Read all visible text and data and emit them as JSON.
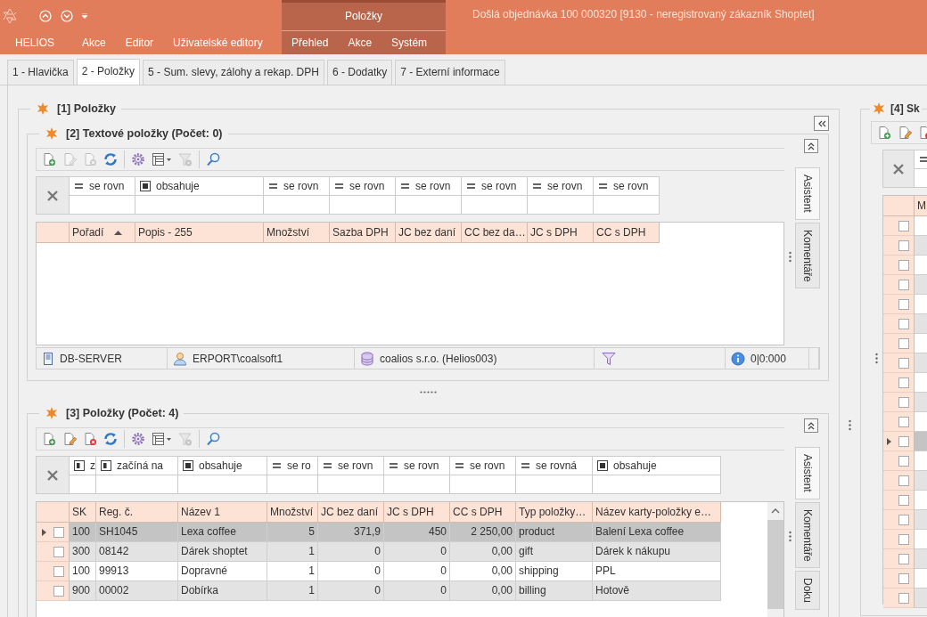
{
  "title_bar": {
    "title": "Došlá objednávka 100 000320 [9130 - neregistrovaný zákazník Shoptet]"
  },
  "ribbon": {
    "menu": [
      "HELIOS",
      "Akce",
      "Editor",
      "Uživatelské editory"
    ],
    "context_group": {
      "label": "Položky",
      "menu": [
        "Přehled",
        "Akce",
        "Systém"
      ]
    }
  },
  "tabs": [
    {
      "label": "1 - Hlavička",
      "selected": false
    },
    {
      "label": "2 - Položky",
      "selected": true
    },
    {
      "label": "5 - Sum. slevy, zálohy a rekap. DPH",
      "selected": false
    },
    {
      "label": "6 - Dodatky",
      "selected": false
    },
    {
      "label": "7 - Externí informace",
      "selected": false
    }
  ],
  "main_group": {
    "title": "[1] Položky"
  },
  "text_items": {
    "title": "[2] Textové položky (Počet: 0)",
    "toolbar": [
      {
        "kind": "add",
        "disabled": false
      },
      {
        "kind": "edit",
        "disabled": true
      },
      {
        "kind": "delete",
        "disabled": true
      },
      {
        "kind": "refresh",
        "disabled": false
      },
      {
        "kind": "separator"
      },
      {
        "kind": "settings",
        "disabled": false
      },
      {
        "kind": "columns",
        "disabled": false
      },
      {
        "kind": "filter_clear",
        "disabled": true
      },
      {
        "kind": "separator"
      },
      {
        "kind": "search",
        "disabled": false
      }
    ],
    "filters": [
      {
        "kind": "equals",
        "text": "se rovn"
      },
      {
        "kind": "contains",
        "text": "obsahuje"
      },
      {
        "kind": "equals",
        "text": "se rovn"
      },
      {
        "kind": "equals",
        "text": "se rovn"
      },
      {
        "kind": "equals",
        "text": "se rovn"
      },
      {
        "kind": "equals",
        "text": "se rovn"
      },
      {
        "kind": "equals",
        "text": "se rovn"
      },
      {
        "kind": "equals",
        "text": "se rovn"
      }
    ],
    "columns": [
      {
        "label": "Pořadí",
        "sorted": true
      },
      {
        "label": "Popis - 255",
        "sorted": false
      },
      {
        "label": "Množství",
        "sorted": false
      },
      {
        "label": "Sazba DPH",
        "sorted": false
      },
      {
        "label": "JC bez daní",
        "sorted": false
      },
      {
        "label": "CC bez da…",
        "sorted": false
      },
      {
        "label": "JC s DPH",
        "sorted": false
      },
      {
        "label": "CC s DPH",
        "sorted": false
      }
    ],
    "side_tabs": [
      {
        "label": "Asistent",
        "selected": true
      },
      {
        "label": "Komentáře",
        "selected": false
      }
    ],
    "status_bar": [
      {
        "kind": "server",
        "text": "DB-SERVER"
      },
      {
        "kind": "user",
        "text": "ERPORT\\coalsoft1"
      },
      {
        "kind": "database",
        "text": "coalios s.r.o. (Helios003)"
      },
      {
        "kind": "filter"
      },
      {
        "kind": "info",
        "text": "0|0:000"
      },
      {
        "kind": "empty"
      }
    ]
  },
  "items": {
    "title": "[3] Položky (Počet: 4)",
    "toolbar": [
      {
        "kind": "add",
        "disabled": false
      },
      {
        "kind": "edit",
        "disabled": false
      },
      {
        "kind": "delete",
        "disabled": false
      },
      {
        "kind": "refresh",
        "disabled": false
      },
      {
        "kind": "separator"
      },
      {
        "kind": "settings",
        "disabled": false
      },
      {
        "kind": "columns",
        "disabled": false
      },
      {
        "kind": "filter_clear",
        "disabled": true
      },
      {
        "kind": "separator"
      },
      {
        "kind": "search",
        "disabled": false
      }
    ],
    "filters": [
      {
        "kind": "starts",
        "text": "z"
      },
      {
        "kind": "starts",
        "text": "začíná na"
      },
      {
        "kind": "contains",
        "text": "obsahuje"
      },
      {
        "kind": "equals",
        "text": "se ro"
      },
      {
        "kind": "equals",
        "text": "se rovn"
      },
      {
        "kind": "equals",
        "text": "se rovn"
      },
      {
        "kind": "equals",
        "text": "se rovn"
      },
      {
        "kind": "equals",
        "text": "se rovná"
      },
      {
        "kind": "contains",
        "text": "obsahuje"
      }
    ],
    "columns": [
      {
        "label": "SK",
        "sorted": false,
        "kind": "text"
      },
      {
        "label": "Reg. č.",
        "sorted": false,
        "kind": "text"
      },
      {
        "label": "Název 1",
        "sorted": false,
        "kind": "text"
      },
      {
        "label": "Množství",
        "sorted": false,
        "kind": "number"
      },
      {
        "label": "JC bez daní",
        "sorted": false,
        "kind": "number"
      },
      {
        "label": "JC s DPH",
        "sorted": false,
        "kind": "number"
      },
      {
        "label": "CC s DPH",
        "sorted": false,
        "kind": "number"
      },
      {
        "label": "Typ položky…",
        "sorted": false,
        "kind": "text"
      },
      {
        "label": "Název karty-položky e…",
        "sorted": false,
        "kind": "text"
      }
    ],
    "rows": [
      {
        "selected": true,
        "checked": false,
        "cells": [
          "100",
          "SH1045",
          "Lexa coffee",
          "5",
          "371,9",
          "450",
          "2 250,00",
          "product",
          "Balení Lexa coffee"
        ]
      },
      {
        "selected": false,
        "checked": false,
        "cells": [
          "300",
          "08142",
          "Dárek shoptet",
          "1",
          "0",
          "0",
          "0,00",
          "gift",
          "Dárek k nákupu"
        ]
      },
      {
        "selected": false,
        "checked": false,
        "cells": [
          "100",
          "99913",
          "Dopravné",
          "1",
          "0",
          "0",
          "0,00",
          "shipping",
          "PPL"
        ]
      },
      {
        "selected": false,
        "checked": false,
        "cells": [
          "900",
          "00002",
          "Dobírka",
          "1",
          "0",
          "0",
          "0,00",
          "billing",
          "Hotově"
        ]
      }
    ],
    "side_tabs": [
      {
        "label": "Asistent",
        "selected": true
      },
      {
        "label": "Komentáře",
        "selected": false
      },
      {
        "label": "Doku",
        "selected": false
      }
    ]
  },
  "right_panel": {
    "title": "[4] Sk",
    "toolbar": [
      {
        "kind": "add",
        "disabled": false
      },
      {
        "kind": "edit",
        "disabled": false
      },
      {
        "kind": "delete",
        "disabled": false
      }
    ],
    "filters": [
      {
        "kind": "equals"
      }
    ],
    "columns": [
      {
        "label": "M",
        "sorted": false
      }
    ],
    "rows": [
      {
        "selected": false,
        "checked": false
      },
      {
        "selected": false,
        "checked": false
      },
      {
        "selected": false,
        "checked": false
      },
      {
        "selected": false,
        "checked": false
      },
      {
        "selected": false,
        "checked": false
      },
      {
        "selected": false,
        "checked": false
      },
      {
        "selected": false,
        "checked": false
      },
      {
        "selected": false,
        "checked": false
      },
      {
        "selected": false,
        "checked": false
      },
      {
        "selected": false,
        "checked": false
      },
      {
        "selected": false,
        "checked": false
      },
      {
        "selected": true,
        "checked": false
      },
      {
        "selected": false,
        "checked": false
      },
      {
        "selected": false,
        "checked": false
      },
      {
        "selected": false,
        "checked": false
      },
      {
        "selected": false,
        "checked": false
      },
      {
        "selected": false,
        "checked": false
      },
      {
        "selected": false,
        "checked": false
      },
      {
        "selected": false,
        "checked": false
      },
      {
        "selected": false,
        "checked": false
      }
    ]
  }
}
